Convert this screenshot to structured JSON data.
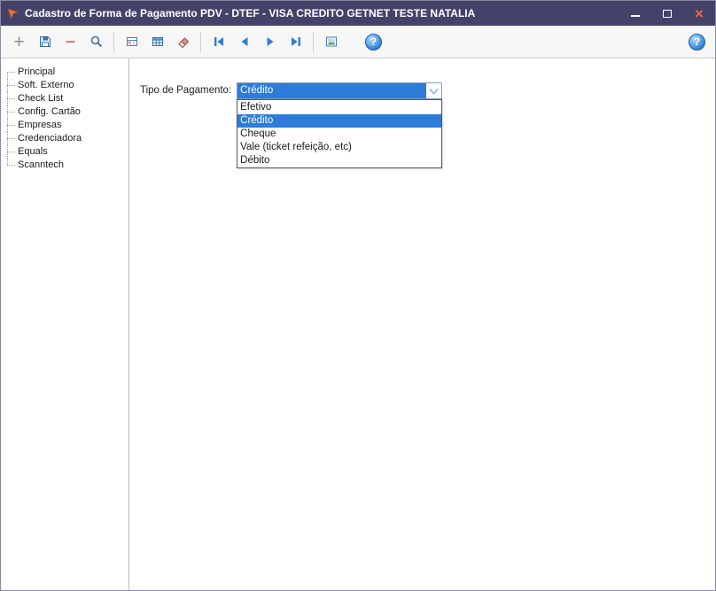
{
  "window": {
    "title": "Cadastro de Forma de Pagamento PDV - DTEF - VISA CREDITO GETNET TESTE NATALIA",
    "controls": {
      "close_glyph": "×"
    }
  },
  "toolbar": {
    "add_glyph": "+",
    "delete_glyph": "−",
    "help_glyph": "?"
  },
  "sidebar": {
    "items": [
      "Principal",
      "Soft. Externo",
      "Check List",
      "Config. Cartão",
      "Empresas",
      "Credenciadora",
      "Equals",
      "Scanntech"
    ]
  },
  "main": {
    "payment_type_label": "Tipo de Pagamento:",
    "combobox": {
      "value": "Crédito",
      "selected_index": 1,
      "options": [
        "Efetivo",
        "Crédito",
        "Cheque",
        "Vale (ticket refeição, etc)",
        "Débito"
      ]
    }
  },
  "colors": {
    "titlebar": "#454269",
    "selection": "#2e7cd9",
    "close": "#f26649"
  }
}
